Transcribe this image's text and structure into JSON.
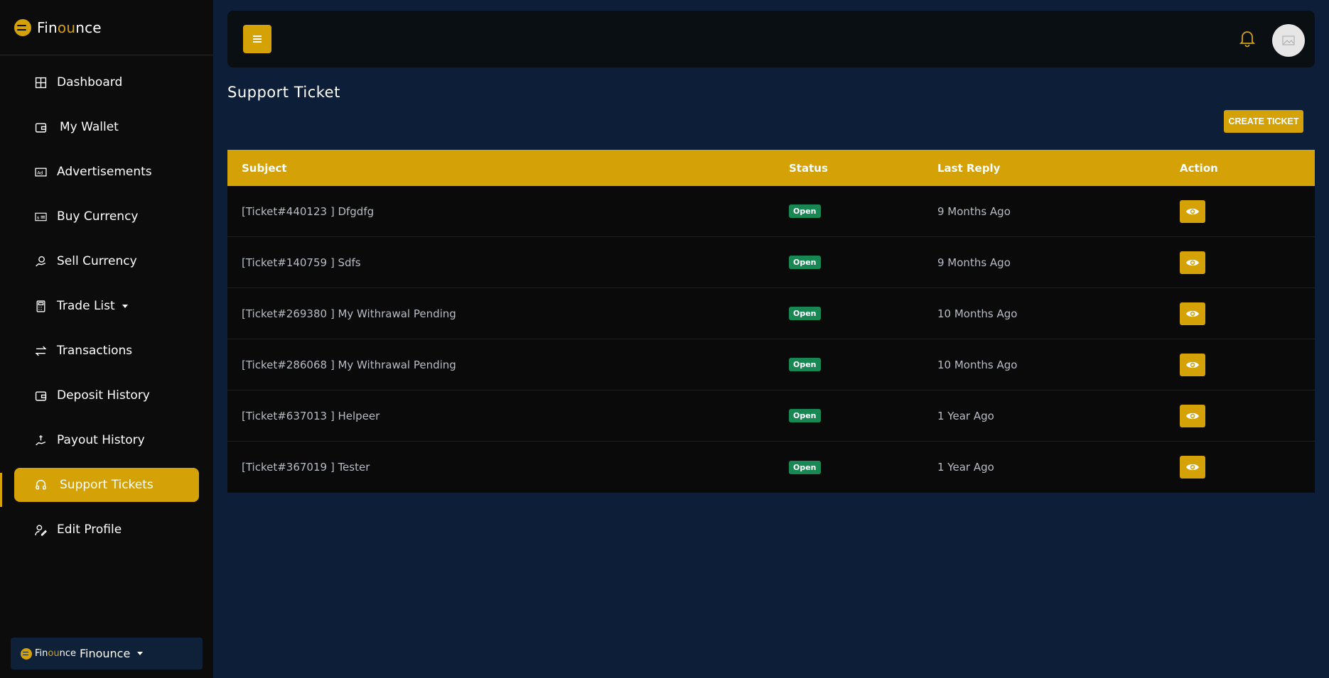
{
  "brand": {
    "name_prefix": "Fin",
    "name_highlight": "ou",
    "name_suffix": "nce"
  },
  "sidebar": {
    "items": [
      {
        "label": "Dashboard",
        "icon": "grid-icon"
      },
      {
        "label": "My Wallet",
        "icon": "wallet-icon"
      },
      {
        "label": "Advertisements",
        "icon": "ad-icon"
      },
      {
        "label": "Buy Currency",
        "icon": "money-icon"
      },
      {
        "label": "Sell Currency",
        "icon": "hand-coin-icon"
      },
      {
        "label": "Trade List",
        "icon": "calculator-icon"
      },
      {
        "label": "Transactions",
        "icon": "exchange-icon"
      },
      {
        "label": "Deposit History",
        "icon": "wallet-icon"
      },
      {
        "label": "Payout History",
        "icon": "hand-money-icon"
      },
      {
        "label": "Support Tickets",
        "icon": "headset-icon",
        "active": true
      },
      {
        "label": "Edit Profile",
        "icon": "user-edit-icon"
      }
    ],
    "footer": {
      "brand_prefix": "Fin",
      "brand_highlight": "ou",
      "brand_suffix": "nce",
      "user_name": "Finounce"
    }
  },
  "header": {
    "menu_icon": "hamburger-icon",
    "bell_icon": "bell-icon",
    "avatar_icon": "image-placeholder-icon"
  },
  "main": {
    "title": "Support Ticket",
    "create_button": "CREATE TICKET",
    "table": {
      "headers": [
        "Subject",
        "Status",
        "Last Reply",
        "Action"
      ],
      "rows": [
        {
          "subject": "[Ticket#440123 ] Dfgdfg",
          "status": "Open",
          "last_reply": "9 Months Ago"
        },
        {
          "subject": "[Ticket#140759 ] Sdfs",
          "status": "Open",
          "last_reply": "9 Months Ago"
        },
        {
          "subject": "[Ticket#269380 ] My Withrawal Pending",
          "status": "Open",
          "last_reply": "10 Months Ago"
        },
        {
          "subject": "[Ticket#286068 ] My Withrawal Pending",
          "status": "Open",
          "last_reply": "10 Months Ago"
        },
        {
          "subject": "[Ticket#637013 ] Helpeer",
          "status": "Open",
          "last_reply": "1 Year Ago"
        },
        {
          "subject": "[Ticket#367019 ] Tester",
          "status": "Open",
          "last_reply": "1 Year Ago"
        }
      ]
    }
  },
  "colors": {
    "accent": "#d4a106",
    "background": "#0d1f38",
    "sidebar": "#0c0c0c",
    "status_open": "#198754"
  }
}
